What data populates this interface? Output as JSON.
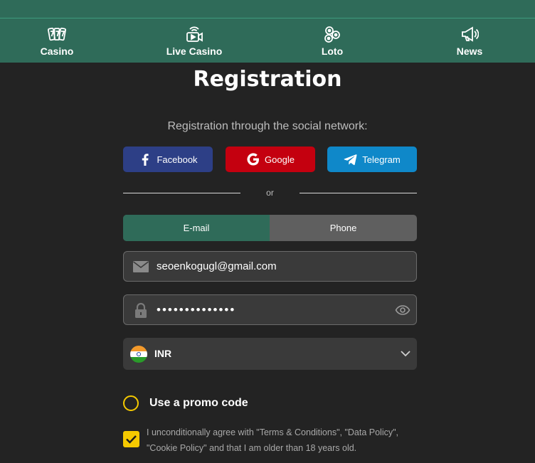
{
  "nav": {
    "items": [
      {
        "label": "Casino",
        "icon": "slot-777-icon"
      },
      {
        "label": "Live Casino",
        "icon": "live-video-icon"
      },
      {
        "label": "Loto",
        "icon": "lottery-balls-icon"
      },
      {
        "label": "News",
        "icon": "megaphone-icon"
      }
    ]
  },
  "page": {
    "title": "Registration",
    "social_caption": "Registration through the social network:"
  },
  "social": {
    "facebook": "Facebook",
    "google": "Google",
    "telegram": "Telegram"
  },
  "divider": {
    "or": "or"
  },
  "method_tabs": {
    "email": "E-mail",
    "phone": "Phone",
    "active": "email"
  },
  "form": {
    "email_value": "seoenkogugl@gmail.com",
    "password_mask": "••••••••••••••",
    "currency": "INR"
  },
  "promo": {
    "label": "Use a promo code",
    "checked": false
  },
  "agreement": {
    "text": "I unconditionally agree with \"Terms & Conditions\", \"Data Policy\", \"Cookie Policy\" and that I am older than 18 years old.",
    "checked": true
  },
  "colors": {
    "nav_bg": "#2f6b59",
    "page_bg": "#232323",
    "facebook": "#2d3f86",
    "google": "#c4000f",
    "telegram": "#0f88c9",
    "accent_yellow": "#f5c900",
    "tab_inactive": "#5f5f5f"
  }
}
